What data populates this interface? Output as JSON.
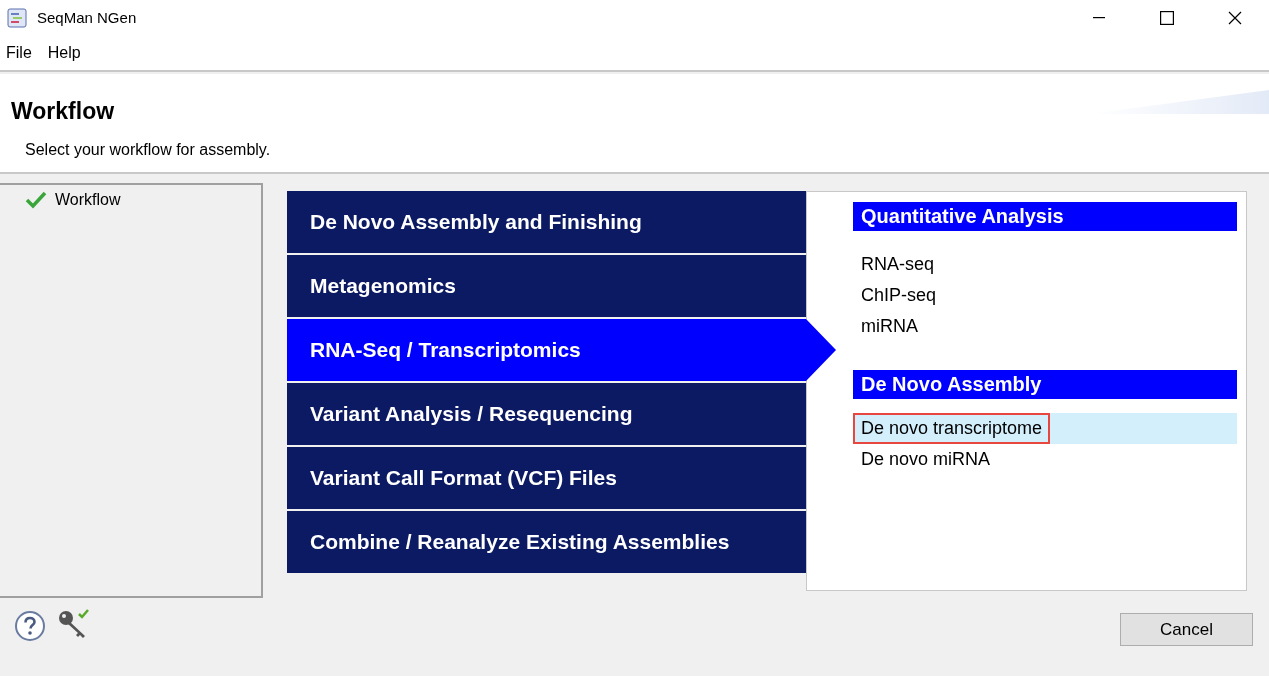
{
  "window": {
    "title": "SeqMan NGen"
  },
  "menu": [
    "File",
    "Help"
  ],
  "header": {
    "title": "Workflow",
    "subtitle": "Select your workflow for assembly."
  },
  "tree": [
    {
      "label": "Workflow",
      "checked": true
    }
  ],
  "workflows": [
    {
      "label": "De Novo Assembly and Finishing",
      "selected": false
    },
    {
      "label": "Metagenomics",
      "selected": false
    },
    {
      "label": "RNA-Seq / Transcriptomics",
      "selected": true
    },
    {
      "label": "Variant Analysis / Resequencing",
      "selected": false
    },
    {
      "label": "Variant Call Format (VCF) Files",
      "selected": false
    },
    {
      "label": "Combine / Reanalyze Existing Assemblies",
      "selected": false
    }
  ],
  "sections": [
    {
      "title": "Quantitative Analysis",
      "items": [
        {
          "label": "RNA-seq",
          "selected": false,
          "outlined": false
        },
        {
          "label": "ChIP-seq",
          "selected": false,
          "outlined": false
        },
        {
          "label": "miRNA",
          "selected": false,
          "outlined": false
        }
      ]
    },
    {
      "title": "De Novo Assembly",
      "items": [
        {
          "label": "De novo transcriptome",
          "selected": true,
          "outlined": true
        },
        {
          "label": "De novo miRNA",
          "selected": false,
          "outlined": false
        }
      ]
    }
  ],
  "buttons": {
    "cancel": "Cancel"
  }
}
